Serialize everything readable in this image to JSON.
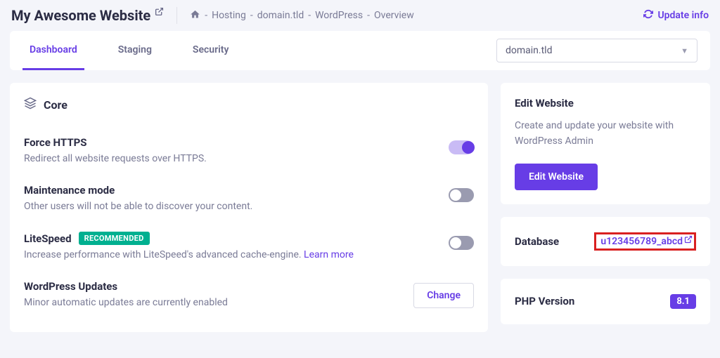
{
  "header": {
    "site_title": "My Awesome Website",
    "breadcrumb": {
      "items": [
        "Hosting",
        "domain.tld",
        "WordPress",
        "Overview"
      ]
    },
    "update_info_label": "Update info"
  },
  "tabs": {
    "items": [
      {
        "label": "Dashboard",
        "active": true
      },
      {
        "label": "Staging",
        "active": false
      },
      {
        "label": "Security",
        "active": false
      }
    ],
    "domain_selected": "domain.tld"
  },
  "core": {
    "title": "Core",
    "settings": {
      "force_https": {
        "title": "Force HTTPS",
        "desc": "Redirect all website requests over HTTPS.",
        "enabled": true
      },
      "maintenance": {
        "title": "Maintenance mode",
        "desc": "Other users will not be able to discover your content.",
        "enabled": false
      },
      "litespeed": {
        "title": "LiteSpeed",
        "badge": "RECOMMENDED",
        "desc": "Increase performance with LiteSpeed's advanced cache-engine. ",
        "learn_more": "Learn more",
        "enabled": false
      },
      "wp_updates": {
        "title": "WordPress Updates",
        "desc": "Minor automatic updates are currently enabled",
        "button": "Change"
      }
    }
  },
  "sidebar": {
    "edit_website": {
      "title": "Edit Website",
      "desc": "Create and update your website with WordPress Admin",
      "button": "Edit Website"
    },
    "database": {
      "label": "Database",
      "value": "u123456789_abcd"
    },
    "php_version": {
      "label": "PHP Version",
      "value": "8.1"
    }
  }
}
